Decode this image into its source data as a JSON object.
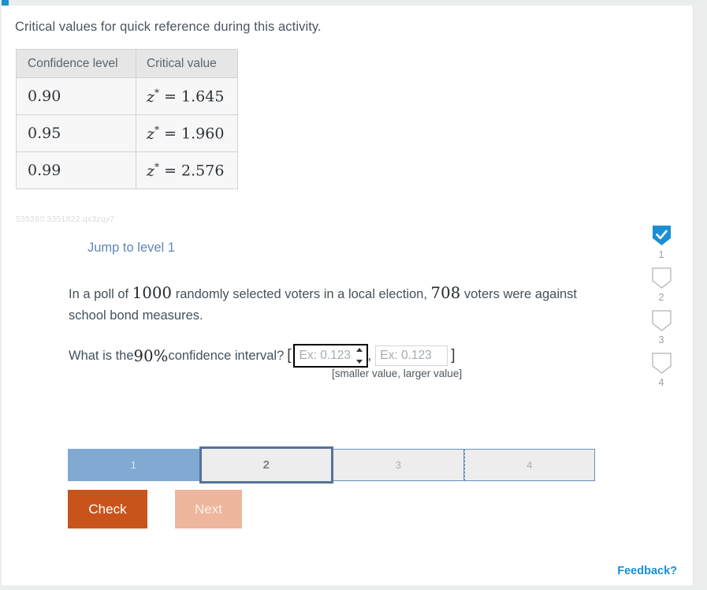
{
  "reference": {
    "caption": "Critical values for quick reference during this activity.",
    "headers": [
      "Confidence level",
      "Critical value"
    ],
    "rows": [
      {
        "level": "0.90",
        "critical": "z* = 1.645",
        "z_symbol": "z",
        "star": "*",
        "eq": "=",
        "value": "1.645"
      },
      {
        "level": "0.95",
        "critical": "z* = 1.960",
        "z_symbol": "z",
        "star": "*",
        "eq": "=",
        "value": "1.960"
      },
      {
        "level": "0.99",
        "critical": "z* = 2.576",
        "z_symbol": "z",
        "star": "*",
        "eq": "=",
        "value": "2.576"
      }
    ],
    "activity_id": "535260.3351822.qx3zqy7"
  },
  "question": {
    "jump_link": "Jump to level 1",
    "stem_prefix": "In a poll of ",
    "sample_size": "1000",
    "stem_middle": " randomly selected voters in a local election, ",
    "count": "708",
    "stem_suffix": " voters were against school bond measures.",
    "prompt_prefix": "What is the ",
    "confidence": "90%",
    "prompt_suffix": " confidence interval?",
    "open_bracket": "[",
    "comma": ",",
    "close_bracket": "]",
    "hint": "[smaller value, larger value]",
    "input_lower": {
      "value": "",
      "placeholder": "Ex: 0.123",
      "focused": true
    },
    "input_upper": {
      "value": "",
      "placeholder": "Ex: 0.123",
      "focused": false
    }
  },
  "progress": {
    "segments": [
      {
        "label": "1",
        "state": "done"
      },
      {
        "label": "2",
        "state": "current"
      },
      {
        "label": "3",
        "state": "todo"
      },
      {
        "label": "4",
        "state": "todo"
      }
    ]
  },
  "actions": {
    "check_label": "Check",
    "next_label": "Next"
  },
  "rail": {
    "items": [
      {
        "number": "1",
        "checked": true
      },
      {
        "number": "2",
        "checked": false
      },
      {
        "number": "3",
        "checked": false
      },
      {
        "number": "4",
        "checked": false
      }
    ]
  },
  "footer": {
    "feedback_label": "Feedback?"
  },
  "colors": {
    "accent_blue": "#1a8fd4",
    "link_blue": "#5e87b4",
    "check_orange": "#c9541b",
    "next_orange": "#eeb69c",
    "segment_done": "#81aad2",
    "segment_border": "#557399"
  }
}
